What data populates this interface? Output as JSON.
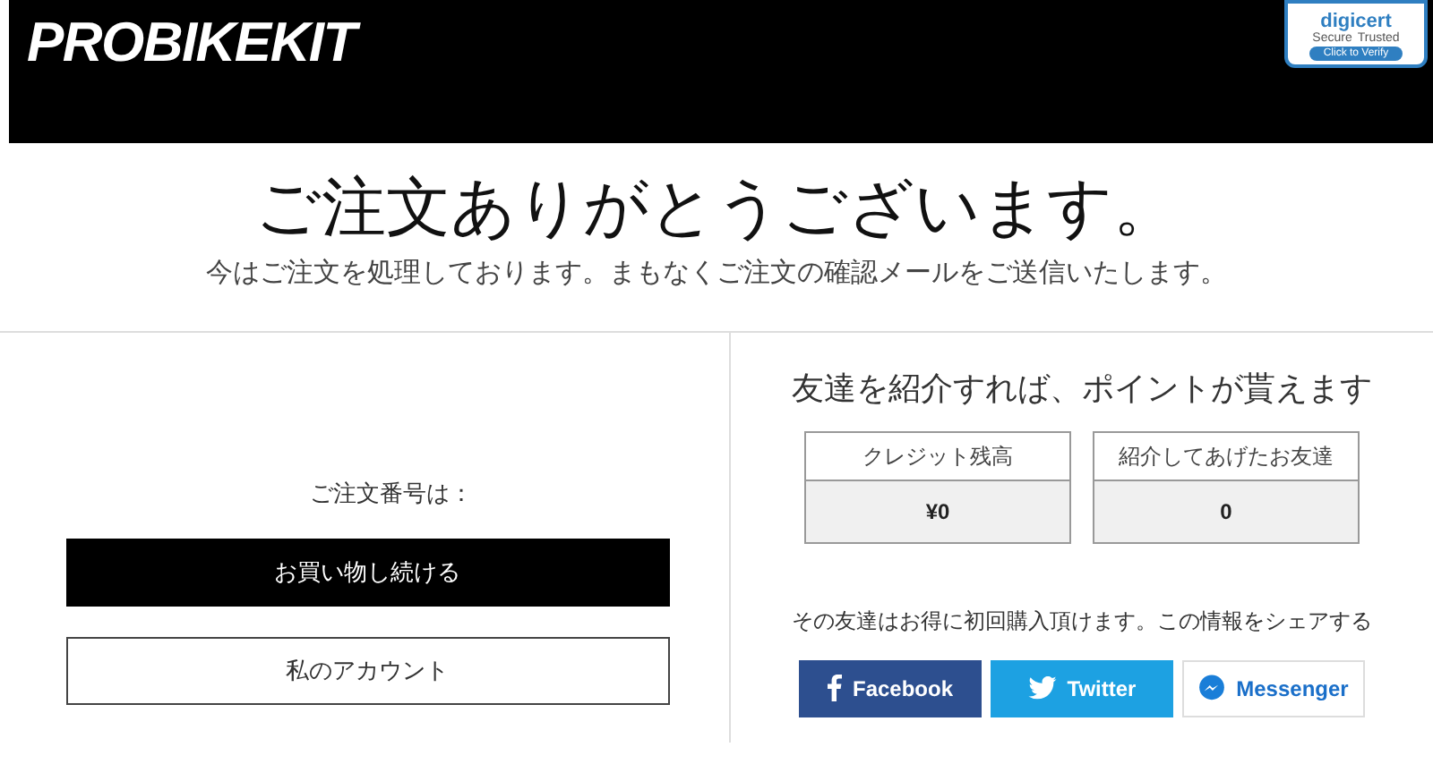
{
  "header": {
    "logo": "PROBIKEKIT",
    "badge": {
      "brand": "digicert",
      "secure": "Secure",
      "trusted": "Trusted",
      "verify": "Click to Verify"
    }
  },
  "title": "ご注文ありがとうございます。",
  "subtitle": "今はご注文を処理しております。まもなくご注文の確認メールをご送信いたします。",
  "order": {
    "label": "ご注文番号は："
  },
  "buttons": [
    {
      "label": "お買い物し続ける",
      "kind": "primary"
    },
    {
      "label": "私のアカウント",
      "kind": "outline"
    }
  ],
  "referral": {
    "heading": "友達を紹介すれば、ポイントが貰えます",
    "stats": [
      {
        "label": "クレジット残高",
        "value": "¥0"
      },
      {
        "label": "紹介してあげたお友達",
        "value": "0"
      }
    ],
    "share_text": "その友達はお得に初回購入頂けます。この情報をシェアする",
    "share_buttons": [
      {
        "label": "Facebook",
        "kind": "facebook"
      },
      {
        "label": "Twitter",
        "kind": "twitter"
      },
      {
        "label": "Messenger",
        "kind": "messenger"
      }
    ]
  }
}
